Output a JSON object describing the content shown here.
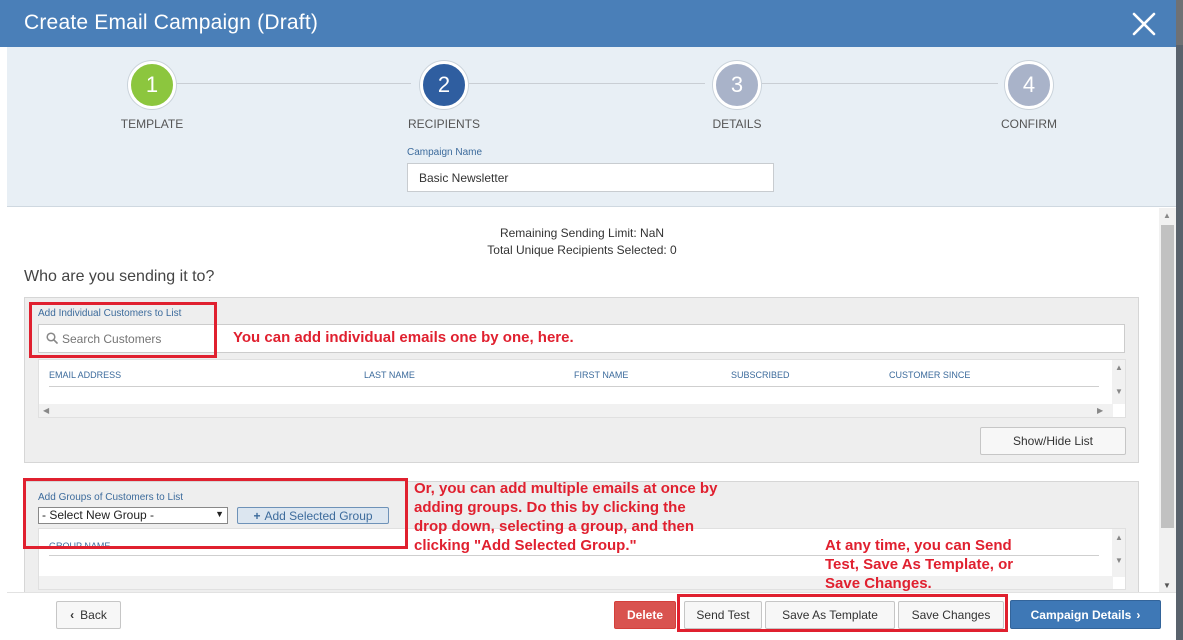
{
  "modal": {
    "title": "Create Email Campaign (Draft)"
  },
  "steps": [
    {
      "number": "1",
      "label": "TEMPLATE",
      "color": "#8cc63e"
    },
    {
      "number": "2",
      "label": "RECIPIENTS",
      "color": "#2f5ea0"
    },
    {
      "number": "3",
      "label": "DETAILS",
      "color": "#a9b3c9"
    },
    {
      "number": "4",
      "label": "CONFIRM",
      "color": "#a9b3c9"
    }
  ],
  "campaign": {
    "name_label": "Campaign Name",
    "name_value": "Basic Newsletter"
  },
  "status": {
    "remaining_limit": "Remaining Sending Limit: NaN",
    "total_recipients": "Total Unique Recipients Selected: 0"
  },
  "section_heading": "Who are you sending it to?",
  "individuals": {
    "label": "Add Individual Customers to List",
    "search_placeholder": "Search Customers",
    "columns": [
      "EMAIL ADDRESS",
      "LAST NAME",
      "FIRST NAME",
      "SUBSCRIBED",
      "CUSTOMER SINCE"
    ],
    "toggle_button": "Show/Hide List"
  },
  "groups": {
    "label": "Add Groups of Customers to List",
    "select_value": "- Select New Group -",
    "add_button": "Add Selected Group",
    "columns": [
      "GROUP NAME"
    ]
  },
  "annotations": {
    "individual_note": "You can add individual emails one by one, here.",
    "group_note": [
      "Or, you can add multiple emails at once by",
      "adding groups. Do this by clicking the",
      "drop down, selecting a group, and then",
      "clicking \"Add Selected Group.\""
    ],
    "footer_note": [
      "At any time, you can Send",
      "Test, Save As Template, or",
      "Save Changes."
    ],
    "color": "#e0202f"
  },
  "footer": {
    "back": "Back",
    "delete": "Delete",
    "send_test": "Send Test",
    "save_template": "Save As Template",
    "save_changes": "Save Changes",
    "campaign_details": "Campaign Details"
  }
}
